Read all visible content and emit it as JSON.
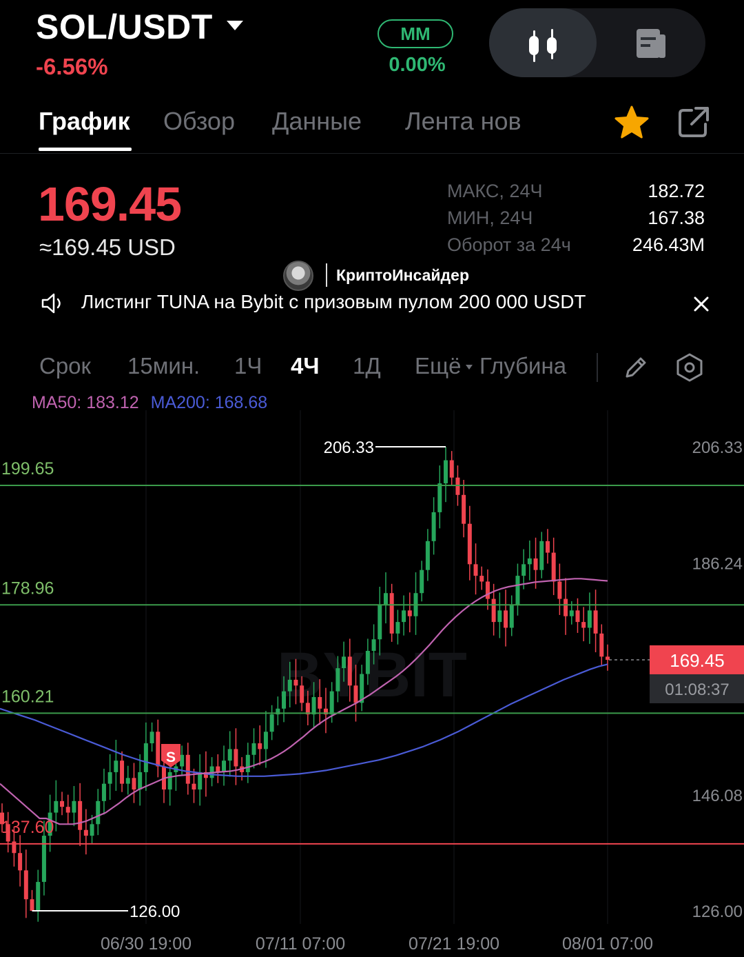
{
  "header": {
    "pair": "SOL/USDT",
    "change": "-6.56%",
    "mm_label": "MM",
    "mm_value": "0.00%"
  },
  "tabs": [
    "График",
    "Обзор",
    "Данные",
    "Лента нов"
  ],
  "price": {
    "last": "169.45",
    "usd": "≈169.45 USD"
  },
  "stats": [
    {
      "label": "МАКС, 24Ч",
      "value": "182.72"
    },
    {
      "label": "МИН, 24Ч",
      "value": "167.38"
    },
    {
      "label": "Оборот за 24ч",
      "value": "246.43M"
    }
  ],
  "watermark": {
    "text": "КриптоИнсайдер"
  },
  "announcement": {
    "text": "Листинг TUNA на Bybit с призовым пулом 200 000 USDT"
  },
  "timeframes": {
    "label": "Срок",
    "items": [
      "15мин.",
      "1Ч",
      "4Ч",
      "1Д",
      "Ещё"
    ],
    "active": "4Ч",
    "depth": "Глубина"
  },
  "indicators": {
    "ma50": "MA50: 183.12",
    "ma200": "MA200: 168.68"
  },
  "colors": {
    "up": "#26a65b",
    "down": "#f0444f",
    "ma50": "#c063b0",
    "ma200": "#4a5bd6",
    "level": "#3b9b4b"
  },
  "chart_data": {
    "type": "candlestick",
    "symbol": "SOL/USDT",
    "interval": "4Ч",
    "y_ticks": [
      "206.33",
      "186.24",
      "146.08",
      "126.00"
    ],
    "x_ticks": [
      "06/30 19:00",
      "07/11 07:00",
      "07/21 19:00",
      "08/01 07:00"
    ],
    "ylim": [
      126.0,
      206.33
    ],
    "high_marker": "206.33",
    "low_marker": "126.00",
    "levels": [
      {
        "label": "199.65",
        "value": 199.65,
        "color": "green"
      },
      {
        "label": "178.96",
        "value": 178.96,
        "color": "green"
      },
      {
        "label": "160.21",
        "value": 160.21,
        "color": "green"
      },
      {
        "label": "137.60",
        "value": 137.6,
        "color": "red"
      }
    ],
    "last_price": "169.45",
    "countdown": "01:08:37",
    "signal": "S",
    "watermark": "BYBIT",
    "closes": [
      141,
      138,
      136,
      133,
      128,
      126,
      131,
      139,
      143,
      145,
      144,
      143,
      145,
      140,
      139,
      141,
      145,
      148,
      150,
      152,
      148,
      149,
      147,
      150,
      155,
      157,
      151,
      147,
      150,
      151,
      153,
      148,
      147,
      150,
      149,
      151,
      150,
      152,
      154,
      151,
      150,
      153,
      155,
      154,
      157,
      160,
      161,
      164,
      166,
      165,
      162,
      160,
      163,
      161,
      160,
      164,
      168,
      170,
      165,
      162,
      167,
      171,
      173,
      179,
      181,
      174,
      176,
      178,
      177,
      181,
      185,
      190,
      195,
      200,
      204,
      201,
      198,
      193,
      186,
      184,
      183,
      180,
      176,
      178,
      175,
      179,
      184,
      186,
      187,
      185,
      190,
      188,
      183,
      180,
      177,
      178,
      176,
      175,
      178,
      174,
      170,
      169.45
    ],
    "ma50": [
      148,
      147,
      146,
      145,
      144,
      143,
      142,
      142,
      141.5,
      141,
      141,
      141,
      141.2,
      141.5,
      142,
      142.5,
      143,
      143.8,
      144.6,
      145.5,
      146.3,
      147,
      147.5,
      148,
      148.5,
      149,
      149.2,
      149.4,
      149.5,
      149.6,
      149.7,
      149.8,
      149.9,
      150,
      150.1,
      150.2,
      150.4,
      150.7,
      151,
      151.4,
      151.8,
      152.3,
      152.9,
      153.6,
      154.4,
      155.3,
      156.2,
      157.2,
      158.1,
      158.9,
      159.6,
      160.2,
      160.8,
      161.4,
      162,
      162.7,
      163.4,
      164.2,
      165,
      165.8,
      166.6,
      167.5,
      168.5,
      169.6,
      170.8,
      172,
      173.3,
      174.6,
      175.8,
      176.9,
      177.9,
      178.8,
      179.6,
      180.3,
      180.9,
      181.4,
      181.8,
      182.1,
      182.3,
      182.5,
      182.7,
      182.9,
      183,
      183.1,
      183.2,
      183.3,
      183.4,
      183.5,
      183.5,
      183.4,
      183.3,
      183.2,
      183.12
    ],
    "ma200": [
      161,
      160.5,
      160,
      159.5,
      159,
      158.4,
      157.8,
      157.2,
      156.6,
      156,
      155.4,
      154.8,
      154.2,
      153.6,
      153,
      152.5,
      152,
      151.6,
      151.2,
      150.8,
      150.5,
      150.2,
      150,
      149.8,
      149.6,
      149.5,
      149.4,
      149.3,
      149.3,
      149.3,
      149.3,
      149.4,
      149.5,
      149.6,
      149.7,
      149.9,
      150.1,
      150.3,
      150.6,
      150.9,
      151.2,
      151.5,
      151.8,
      152.1,
      152.5,
      152.9,
      153.4,
      153.9,
      154.4,
      155,
      155.6,
      156.3,
      157,
      157.8,
      158.6,
      159.4,
      160.2,
      161,
      161.8,
      162.5,
      163.2,
      163.9,
      164.6,
      165.3,
      166,
      166.6,
      167.2,
      167.8,
      168.3,
      168.68
    ]
  }
}
